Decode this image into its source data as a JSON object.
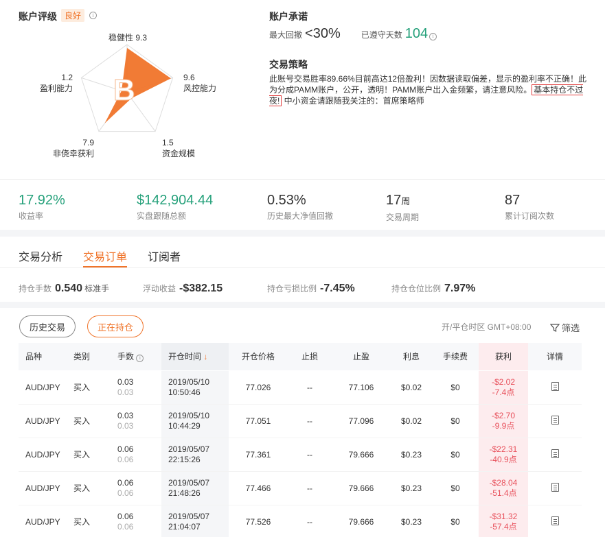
{
  "rating": {
    "title": "账户评级",
    "badge": "良好",
    "grade": "B",
    "axes": [
      {
        "name": "稳健性",
        "value": "9.3"
      },
      {
        "name": "风控能力",
        "value": "9.6"
      },
      {
        "name": "资金规模",
        "value": "1.5"
      },
      {
        "name": "非侥幸获利",
        "value": "7.9"
      },
      {
        "name": "盈利能力",
        "value": "1.2"
      }
    ],
    "accent": "#f0742a"
  },
  "commitment": {
    "title": "账户承诺",
    "max_drawdown_label": "最大回撤",
    "max_drawdown_value": "<30%",
    "days_label": "已遵守天数",
    "days_value": "104"
  },
  "strategy": {
    "title": "交易策略",
    "text_before": "此账号交易胜率89.66%目前高达12倍盈利！因数据读取偏差，显示的盈利率不正确！此为分成PAMM账户，公开，透明！PAMM账户出入金频繁，请注意风险。",
    "highlight": "基本持仓不过夜!",
    "text_after": " 中小资金请跟随我关注的：首席策略师"
  },
  "stats": [
    {
      "value": "17.92%",
      "label": "收益率"
    },
    {
      "value": "$142,904.44",
      "label": "实盘跟随总额"
    },
    {
      "value": "0.53%",
      "label": "历史最大净值回撤"
    },
    {
      "value": "17",
      "unit": "周",
      "label": "交易周期"
    },
    {
      "value": "87",
      "label": "累计订阅次数"
    }
  ],
  "tabs": [
    "交易分析",
    "交易订单",
    "订阅者"
  ],
  "summary": {
    "lots_label": "持仓手数",
    "lots_value": "0.540",
    "lots_unit": "标准手",
    "float_label": "浮动收益",
    "float_value": "-$382.15",
    "loss_ratio_label": "持仓亏损比例",
    "loss_ratio_value": "-7.45%",
    "position_ratio_label": "持仓仓位比例",
    "position_ratio_value": "7.97%"
  },
  "buttons": {
    "history": "历史交易",
    "open": "正在持仓"
  },
  "timezone": "开/平仓时区 GMT+08:00",
  "filter_label": "筛选",
  "columns": [
    "品种",
    "类别",
    "手数",
    "开仓时间",
    "开仓价格",
    "止损",
    "止盈",
    "利息",
    "手续费",
    "获利",
    "详情"
  ],
  "rows": [
    {
      "symbol": "AUD/JPY",
      "type": "买入",
      "lots": "0.03",
      "lots2": "0.03",
      "date": "2019/05/10",
      "time": "10:50:46",
      "open": "77.026",
      "sl": "--",
      "tp": "77.106",
      "interest": "$0.02",
      "fee": "$0",
      "profit": "-$2.02",
      "points": "-7.4点"
    },
    {
      "symbol": "AUD/JPY",
      "type": "买入",
      "lots": "0.03",
      "lots2": "0.03",
      "date": "2019/05/10",
      "time": "10:44:29",
      "open": "77.051",
      "sl": "--",
      "tp": "77.096",
      "interest": "$0.02",
      "fee": "$0",
      "profit": "-$2.70",
      "points": "-9.9点"
    },
    {
      "symbol": "AUD/JPY",
      "type": "买入",
      "lots": "0.06",
      "lots2": "0.06",
      "date": "2019/05/07",
      "time": "22:15:26",
      "open": "77.361",
      "sl": "--",
      "tp": "79.666",
      "interest": "$0.23",
      "fee": "$0",
      "profit": "-$22.31",
      "points": "-40.9点"
    },
    {
      "symbol": "AUD/JPY",
      "type": "买入",
      "lots": "0.06",
      "lots2": "0.06",
      "date": "2019/05/07",
      "time": "21:48:26",
      "open": "77.466",
      "sl": "--",
      "tp": "79.666",
      "interest": "$0.23",
      "fee": "$0",
      "profit": "-$28.04",
      "points": "-51.4点"
    },
    {
      "symbol": "AUD/JPY",
      "type": "买入",
      "lots": "0.06",
      "lots2": "0.06",
      "date": "2019/05/07",
      "time": "21:04:07",
      "open": "77.526",
      "sl": "--",
      "tp": "79.666",
      "interest": "$0.23",
      "fee": "$0",
      "profit": "-$31.32",
      "points": "-57.4点"
    }
  ]
}
